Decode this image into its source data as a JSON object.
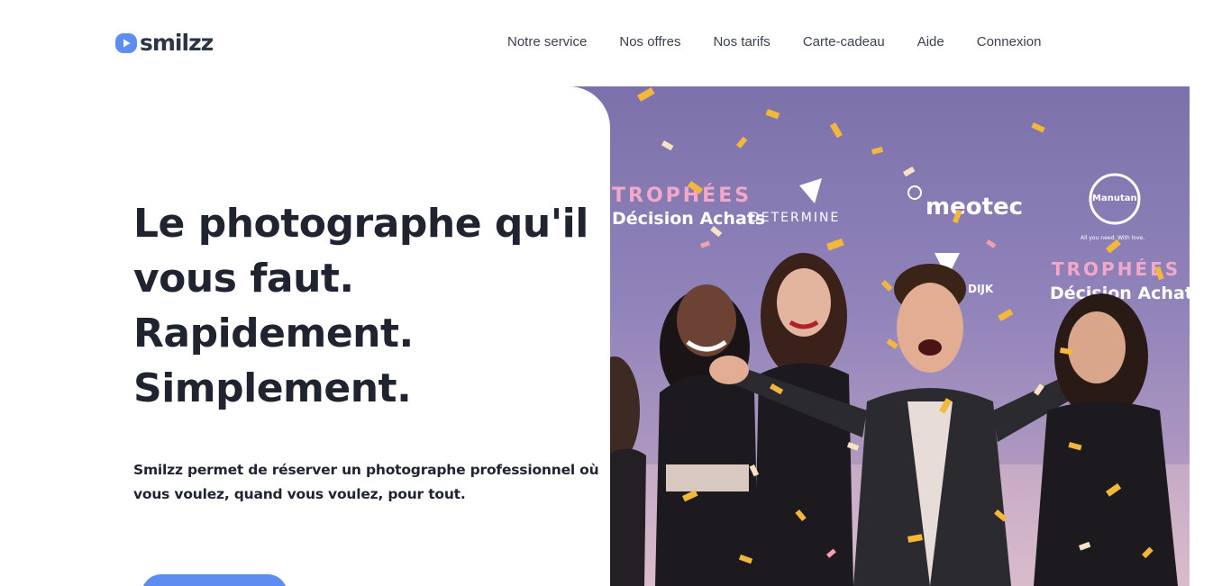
{
  "header": {
    "logo_text": "smilzz",
    "nav": [
      {
        "label": "Notre service"
      },
      {
        "label": "Nos offres"
      },
      {
        "label": "Nos tarifs"
      },
      {
        "label": "Carte-cadeau"
      },
      {
        "label": "Aide"
      },
      {
        "label": "Connexion"
      }
    ]
  },
  "hero": {
    "headline": [
      "Le photographe qu'il",
      "vous faut.",
      "Rapidement.",
      "Simplement."
    ],
    "subtitle": "Smilzz permet de réserver un photographe professionnel où vous voulez, quand vous voulez, pour tout.",
    "photo": {
      "logos": [
        "TROPHÉES",
        "Décision Achats",
        "DETERMINE",
        "meotec",
        "Manutan",
        "VAN DIJK"
      ],
      "logo_small": "All you need. With love."
    }
  },
  "colors": {
    "brand_blue": "#5e8df1",
    "text_dark": "#1f2430",
    "backdrop_purple": "#8d80b4"
  }
}
